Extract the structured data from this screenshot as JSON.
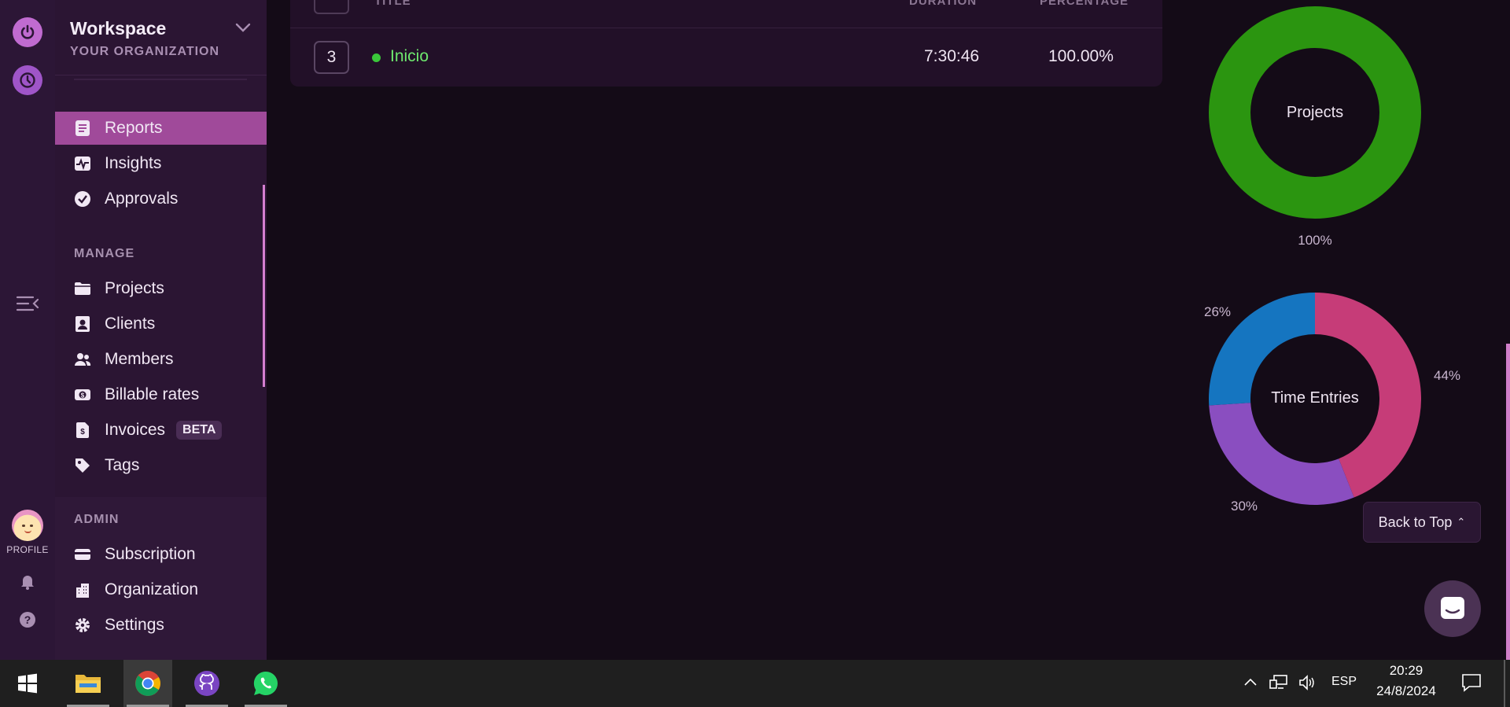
{
  "workspace": {
    "name": "Workspace",
    "org": "YOUR ORGANIZATION"
  },
  "nav": {
    "main": [
      {
        "label": "Reports",
        "active": true
      },
      {
        "label": "Insights"
      },
      {
        "label": "Approvals"
      }
    ],
    "manage_label": "MANAGE",
    "manage": [
      {
        "label": "Projects"
      },
      {
        "label": "Clients"
      },
      {
        "label": "Members"
      },
      {
        "label": "Billable rates"
      },
      {
        "label": "Invoices",
        "badge": "BETA"
      },
      {
        "label": "Tags"
      }
    ],
    "admin_label": "ADMIN",
    "admin": [
      {
        "label": "Subscription"
      },
      {
        "label": "Organization"
      },
      {
        "label": "Settings"
      }
    ]
  },
  "rail": {
    "profile_label": "PROFILE"
  },
  "table": {
    "headers": {
      "title": "TITLE",
      "duration": "DURATION",
      "percentage": "PERCENTAGE"
    },
    "rows": [
      {
        "number": "3",
        "title": "Inicio",
        "duration": "7:30:46",
        "percentage": "100.00%"
      }
    ]
  },
  "charts": {
    "projects": {
      "center_label": "Projects",
      "slices": [
        {
          "value": 100,
          "label": "100%",
          "color": "#2b9510"
        }
      ]
    },
    "time_entries": {
      "center_label": "Time Entries",
      "slices": [
        {
          "value": 44,
          "label": "44%",
          "color": "#c63c78"
        },
        {
          "value": 30,
          "label": "30%",
          "color": "#8a4ec0"
        },
        {
          "value": 26,
          "label": "26%",
          "color": "#1575c0"
        }
      ]
    }
  },
  "back_to_top": "Back to Top",
  "taskbar": {
    "language": "ESP",
    "time": "20:29",
    "date": "24/8/2024"
  }
}
